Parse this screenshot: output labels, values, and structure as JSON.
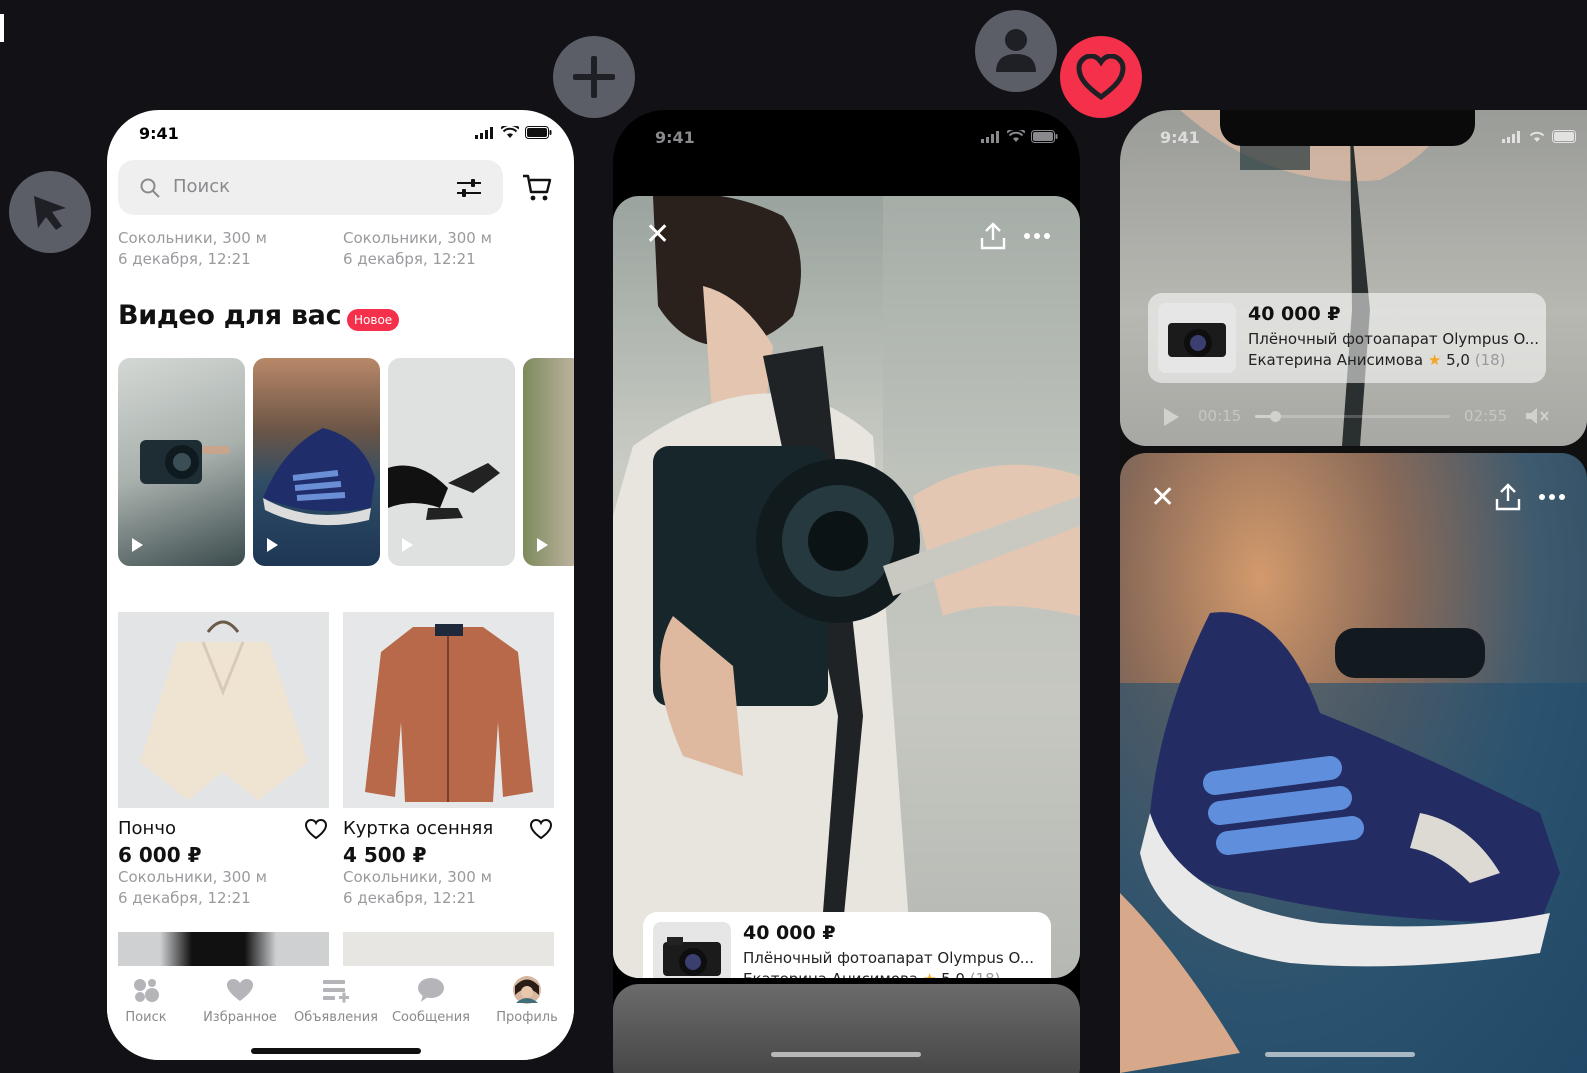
{
  "status": {
    "time": "9:41"
  },
  "search": {
    "placeholder": "Поиск"
  },
  "top_listings": [
    {
      "location": "Сокольники, 300 м",
      "date": "6 декабря, 12:21"
    },
    {
      "location": "Сокольники, 300 м",
      "date": "6 декабря, 12:21"
    }
  ],
  "videos_section": {
    "title": "Видео для вас",
    "badge": "Новое"
  },
  "products": [
    {
      "title": "Пончо",
      "price": "6 000 ₽",
      "location": "Сокольники, 300 м",
      "date": "6 декабря, 12:21"
    },
    {
      "title": "Куртка осенняя",
      "price": "4 500 ₽",
      "location": "Сокольники, 300 м",
      "date": "6 декабря, 12:21"
    }
  ],
  "tabbar": {
    "items": [
      {
        "label": "Поиск",
        "icon": "search-dots-icon"
      },
      {
        "label": "Избранное",
        "icon": "heart-icon"
      },
      {
        "label": "Объявления",
        "icon": "listings-icon"
      },
      {
        "label": "Сообщения",
        "icon": "chat-icon"
      },
      {
        "label": "Профиль",
        "icon": "avatar"
      }
    ]
  },
  "video_card": {
    "price": "40 000 ₽",
    "name": "Плёночный фотоапарат Olympus O...",
    "seller": "Екатерина Анисимова",
    "rating": "5,0",
    "reviews": "(18)"
  },
  "player": {
    "current": "00:15",
    "total": "02:55",
    "progress": 0.1
  },
  "colors": {
    "accent": "#f4304a",
    "background": "#121216",
    "fab": "#5b5e66",
    "star": "#f5a623"
  }
}
